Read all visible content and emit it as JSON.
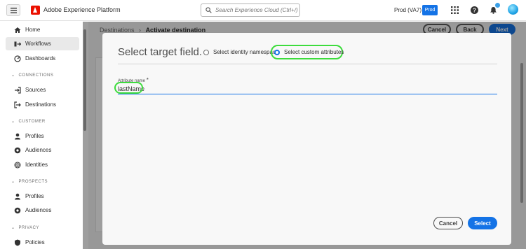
{
  "app": {
    "title": "Adobe Experience Platform"
  },
  "search": {
    "placeholder": "Search Experience Cloud (Ctrl+/)"
  },
  "org": {
    "name": "Prod (VA7)",
    "badge": "Prod"
  },
  "sidebar": {
    "items": [
      {
        "label": "Home",
        "icon": "home-icon"
      },
      {
        "label": "Workflows",
        "icon": "workflows-icon",
        "active": true
      },
      {
        "label": "Dashboards",
        "icon": "dashboards-icon"
      }
    ],
    "sections": [
      {
        "label": "CONNECTIONS",
        "items": [
          {
            "label": "Sources",
            "icon": "sources-icon"
          },
          {
            "label": "Destinations",
            "icon": "destinations-icon"
          }
        ]
      },
      {
        "label": "CUSTOMER",
        "items": [
          {
            "label": "Profiles",
            "icon": "profiles-icon"
          },
          {
            "label": "Audiences",
            "icon": "audiences-icon"
          },
          {
            "label": "Identities",
            "icon": "identities-icon"
          }
        ]
      },
      {
        "label": "PROSPECTS",
        "items": [
          {
            "label": "Profiles",
            "icon": "profiles-icon"
          },
          {
            "label": "Audiences",
            "icon": "audiences-icon"
          }
        ]
      },
      {
        "label": "PRIVACY",
        "items": [
          {
            "label": "Policies",
            "icon": "policies-icon"
          }
        ]
      }
    ]
  },
  "breadcrumb": {
    "parent": "Destinations",
    "separator": "›",
    "current": "Activate destination"
  },
  "header_buttons": {
    "cancel": "Cancel",
    "back": "Back",
    "next": "Next"
  },
  "dialog": {
    "title": "Select target field.",
    "options": [
      {
        "label": "Select identity namespace",
        "selected": false
      },
      {
        "label": "Select custom attributes",
        "selected": true
      }
    ],
    "field_label": "Attribute name",
    "field_required_mark": "*",
    "field_value": "lastName",
    "cancel_label": "Cancel",
    "select_label": "Select"
  },
  "colors": {
    "accent": "#1473e6",
    "highlight": "#3ddc3d",
    "adobe_red": "#eb1000"
  }
}
